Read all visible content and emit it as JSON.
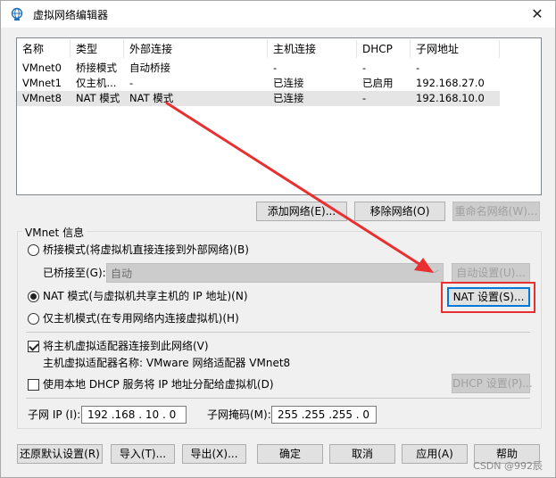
{
  "window": {
    "title": "虚拟网络编辑器",
    "close_glyph": "✕"
  },
  "network_table": {
    "columns": [
      "名称",
      "类型",
      "外部连接",
      "主机连接",
      "DHCP",
      "子网地址"
    ],
    "rows": [
      [
        "VMnet0",
        "桥接模式",
        "自动桥接",
        "-",
        "-",
        "-"
      ],
      [
        "VMnet1",
        "仅主机...",
        "-",
        "已连接",
        "已启用",
        "192.168.27.0"
      ],
      [
        "VMnet8",
        "NAT 模式",
        "NAT 模式",
        "已连接",
        "-",
        "192.168.10.0"
      ]
    ],
    "selected_row": 2
  },
  "table_buttons": {
    "add": "添加网络(E)...",
    "remove": "移除网络(O)",
    "rename": "重命名网络(W)..."
  },
  "vmnet_info": {
    "group_title": "VMnet 信息",
    "bridged_label": "桥接模式(将虚拟机直接连接到外部网络)(B)",
    "bridged_to_label": "已桥接至(G):",
    "bridged_to_value": "自动",
    "auto_settings": "自动设置(U)...",
    "nat_label": "NAT 模式(与虚拟机共享主机的 IP 地址)(N)",
    "nat_settings": "NAT 设置(S)...",
    "hostonly_label": "仅主机模式(在专用网络内连接虚拟机)(H)",
    "mode_selected": "nat",
    "connect_adapter_label": "将主机虚拟适配器连接到此网络(V)",
    "connect_adapter_checked": true,
    "adapter_name_label": "主机虚拟适配器名称: VMware 网络适配器 VMnet8",
    "dhcp_label": "使用本地 DHCP 服务将 IP 地址分配给虚拟机(D)",
    "dhcp_checked": false,
    "dhcp_settings": "DHCP 设置(P)...",
    "subnet_ip_label": "子网 IP (I):",
    "subnet_ip_value": "192 .168 . 10 . 0",
    "subnet_mask_label": "子网掩码(M):",
    "subnet_mask_value": "255 .255 .255 . 0"
  },
  "footer_buttons": {
    "restore_defaults": "还原默认设置(R)",
    "import": "导入(T)...",
    "export": "导出(X)...",
    "ok": "确定",
    "cancel": "取消",
    "apply": "应用(A)",
    "help": "帮助"
  },
  "watermark": "CSDN @992辰",
  "colors": {
    "annotation_red": "#e83030",
    "focus_blue": "#0078d7"
  }
}
